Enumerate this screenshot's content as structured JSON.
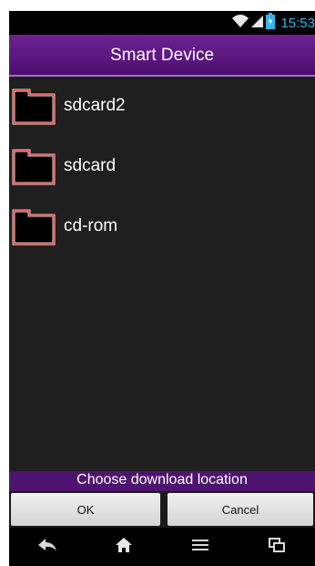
{
  "status_bar": {
    "time": "15:53",
    "icons": [
      "wifi-icon",
      "signal-icon",
      "battery-icon"
    ],
    "clock_color": "#33b5e5"
  },
  "header": {
    "title": "Smart Device",
    "background": "#5b167f"
  },
  "locations": [
    {
      "label": "sdcard2",
      "icon": "folder-icon"
    },
    {
      "label": "sdcard",
      "icon": "folder-icon"
    },
    {
      "label": "cd-rom",
      "icon": "folder-icon"
    }
  ],
  "footer": {
    "text": "Choose download location"
  },
  "buttons": {
    "ok": "OK",
    "cancel": "Cancel"
  },
  "nav": {
    "items": [
      "back-icon",
      "home-icon",
      "menu-icon",
      "recent-apps-icon"
    ]
  }
}
